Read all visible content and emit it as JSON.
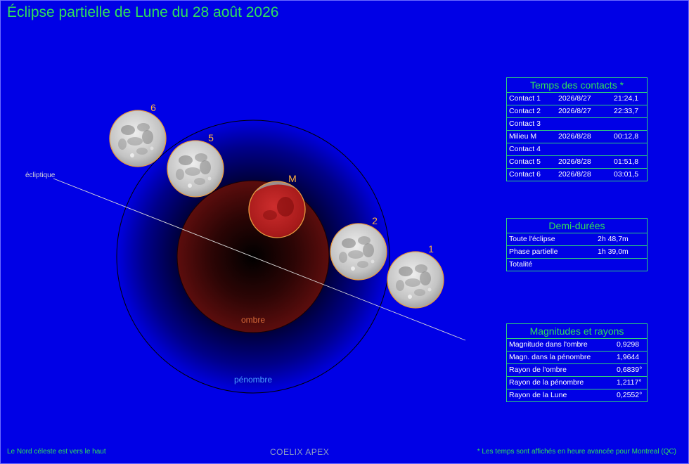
{
  "title": "Éclipse partielle de Lune du 28 août 2026",
  "labels": {
    "ecliptic": "écliptique",
    "umbra": "ombre",
    "penumbra": "pénombre"
  },
  "moons": [
    {
      "label": "6",
      "type": "normal"
    },
    {
      "label": "5",
      "type": "normal"
    },
    {
      "label": "M",
      "type": "eclipsed"
    },
    {
      "label": "2",
      "type": "normal"
    },
    {
      "label": "1",
      "type": "normal"
    }
  ],
  "contacts": {
    "header": "Temps des contacts *",
    "rows": [
      {
        "name": "Contact 1",
        "date": "2026/8/27",
        "time": "21:24,1"
      },
      {
        "name": "Contact 2",
        "date": "2026/8/27",
        "time": "22:33,7"
      },
      {
        "name": "Contact 3",
        "date": "",
        "time": ""
      },
      {
        "name": "Milieu M",
        "date": "2026/8/28",
        "time": "00:12,8"
      },
      {
        "name": "Contact 4",
        "date": "",
        "time": ""
      },
      {
        "name": "Contact 5",
        "date": "2026/8/28",
        "time": "01:51,8"
      },
      {
        "name": "Contact 6",
        "date": "2026/8/28",
        "time": "03:01,5"
      }
    ]
  },
  "half_durations": {
    "header": "Demi-durées",
    "rows": [
      {
        "name": "Toute l'éclipse",
        "value": "2h 48,7m"
      },
      {
        "name": "Phase partielle",
        "value": "1h 39,0m"
      },
      {
        "name": "Totalité",
        "value": ""
      }
    ]
  },
  "magnitudes": {
    "header": "Magnitudes et rayons",
    "rows": [
      {
        "name": "Magnitude dans l'ombre",
        "value": "0,9298"
      },
      {
        "name": "Magn. dans la pénombre",
        "value": "1,9644"
      },
      {
        "name": "Rayon de l'ombre",
        "value": "0,6839°"
      },
      {
        "name": "Rayon de la pénombre",
        "value": "1,2117°"
      },
      {
        "name": "Rayon de la Lune",
        "value": "0,2552°"
      }
    ]
  },
  "footer": {
    "left": "Le Nord céleste est vers le haut",
    "center": "COELIX APEX",
    "right": "* Les temps sont affichés en heure avancée pour Montreal (QC)"
  },
  "colors": {
    "background": "#0000e6",
    "title": "#2fe05a",
    "umbra": "#5a0c0c",
    "moon_label": "#ffb040",
    "eclipsed_moon": "#b01818"
  }
}
